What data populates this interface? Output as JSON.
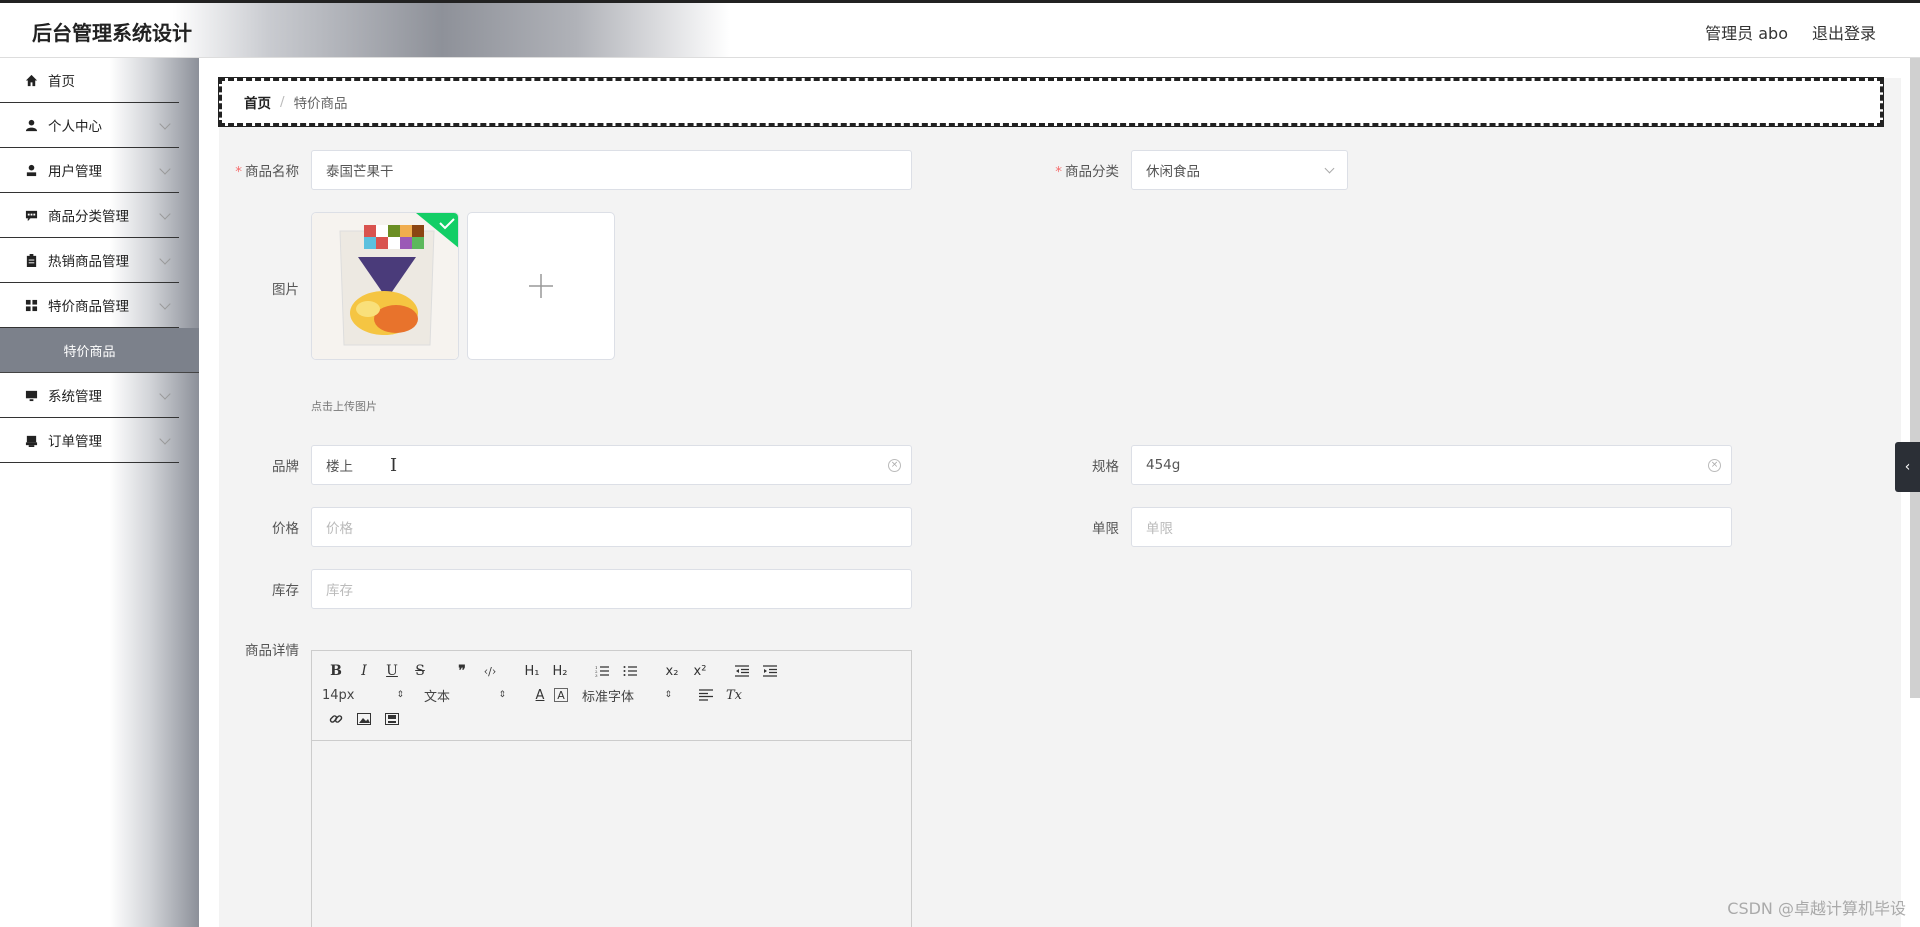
{
  "header": {
    "app_title": "后台管理系统设计",
    "user_label": "管理员 abo",
    "logout_label": "退出登录"
  },
  "sidebar": {
    "items": [
      {
        "label": "首页",
        "icon": "home-icon"
      },
      {
        "label": "个人中心",
        "icon": "user-icon"
      },
      {
        "label": "用户管理",
        "icon": "users-icon"
      },
      {
        "label": "商品分类管理",
        "icon": "chat-icon"
      },
      {
        "label": "热销商品管理",
        "icon": "clipboard-icon"
      },
      {
        "label": "特价商品管理",
        "icon": "grid-icon"
      },
      {
        "label": "特价商品",
        "icon": ""
      },
      {
        "label": "系统管理",
        "icon": "monitor-icon"
      },
      {
        "label": "订单管理",
        "icon": "printer-icon"
      }
    ]
  },
  "breadcrumb": {
    "home": "首页",
    "separator": "/",
    "current": "特价商品"
  },
  "form": {
    "name_label": "商品名称",
    "name_value": "泰国芒果干",
    "category_label": "商品分类",
    "category_value": "休闲食品",
    "image_label": "图片",
    "upload_tip": "点击上传图片",
    "brand_label": "品牌",
    "brand_value": "楼上",
    "spec_label": "规格",
    "spec_value": "454g",
    "price_label": "价格",
    "price_placeholder": "价格",
    "limit_label": "单限",
    "limit_placeholder": "单限",
    "stock_label": "库存",
    "stock_placeholder": "库存",
    "detail_label": "商品详情"
  },
  "editor": {
    "font_size": "14px",
    "block_format": "文本",
    "font_family": "标准字体"
  },
  "watermark": "CSDN @卓越计算机毕设",
  "colors": {
    "required": "#f56c6c",
    "upload_success": "#13ce66",
    "active_submenu": "#7c818b"
  }
}
